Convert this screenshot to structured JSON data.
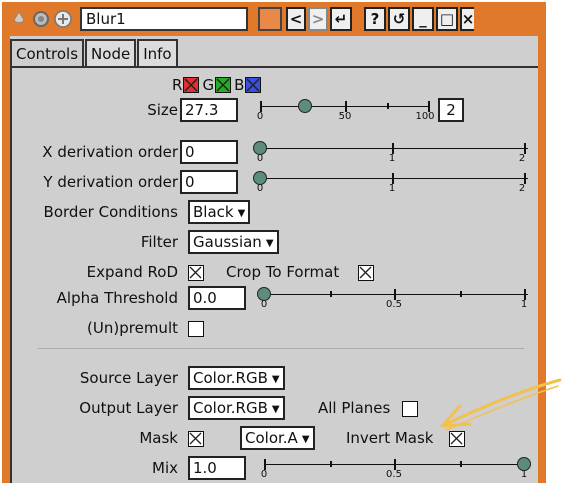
{
  "titlebar": {
    "node_name": "Blur1",
    "buttons": [
      "<",
      ">",
      "↵",
      "?",
      "↺",
      "_",
      "□",
      "×"
    ]
  },
  "tabs": [
    "Controls",
    "Node",
    "Info"
  ],
  "channels": {
    "r": "R",
    "g": "G",
    "b": "B"
  },
  "size": {
    "label": "Size",
    "value": "27.3",
    "ticks": [
      "0",
      "50",
      "100"
    ],
    "extra": "2",
    "level": 0.27
  },
  "xderiv": {
    "label": "X derivation order",
    "value": "0",
    "ticks": [
      "0",
      "1",
      "2"
    ],
    "level": 0
  },
  "yderiv": {
    "label": "Y derivation order",
    "value": "0",
    "ticks": [
      "0",
      "1",
      "2"
    ],
    "level": 0
  },
  "border": {
    "label": "Border Conditions",
    "value": "Black"
  },
  "filter": {
    "label": "Filter",
    "value": "Gaussian"
  },
  "expand": {
    "label": "Expand RoD",
    "checked": true
  },
  "crop": {
    "label": "Crop To Format",
    "checked": true
  },
  "alpha": {
    "label": "Alpha Threshold",
    "value": "0.0",
    "ticks": [
      "0",
      "0.5",
      "1"
    ],
    "level": 0
  },
  "premult": {
    "label": "(Un)premult",
    "checked": false
  },
  "source": {
    "label": "Source Layer",
    "value": "Color.RGB"
  },
  "output": {
    "label": "Output Layer",
    "value": "Color.RGB"
  },
  "allplanes": {
    "label": "All Planes",
    "checked": false
  },
  "mask": {
    "label": "Mask",
    "value": "Color.A",
    "checked": true
  },
  "invertmask": {
    "label": "Invert Mask",
    "checked": true
  },
  "mix": {
    "label": "Mix",
    "value": "1.0",
    "ticks": [
      "0",
      "0.5",
      "1"
    ],
    "level": 1
  },
  "colors": {
    "frame": "#e07a2a",
    "handle": "#5b8c7e",
    "arrow": "#f2c14e",
    "r": "#e03030",
    "g": "#22b022",
    "b": "#3a4ee0"
  }
}
